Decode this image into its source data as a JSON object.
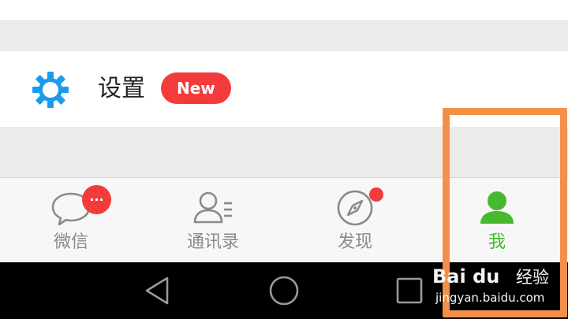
{
  "settings": {
    "label": "设置",
    "badge": "New",
    "icon": "gear-icon",
    "icon_color": "#1a9bef"
  },
  "tabs": [
    {
      "label": "微信",
      "icon": "chat-bubble-icon",
      "badge": "...",
      "active": false
    },
    {
      "label": "通讯录",
      "icon": "contacts-icon",
      "active": false
    },
    {
      "label": "发现",
      "icon": "compass-icon",
      "badge_dot": true,
      "active": false
    },
    {
      "label": "我",
      "icon": "person-icon",
      "active": true
    }
  ],
  "nav": {
    "back": "back-triangle-icon",
    "home": "home-circle-icon",
    "recent": "recents-square-icon"
  },
  "watermark": {
    "logo": "Bai du",
    "logo_suffix": "经验",
    "url": "jingyan.baidu.com"
  },
  "colors": {
    "active": "#46b92f",
    "inactive": "#8a8a8a",
    "badge": "#f43b3b",
    "highlight": "#f2904a"
  }
}
